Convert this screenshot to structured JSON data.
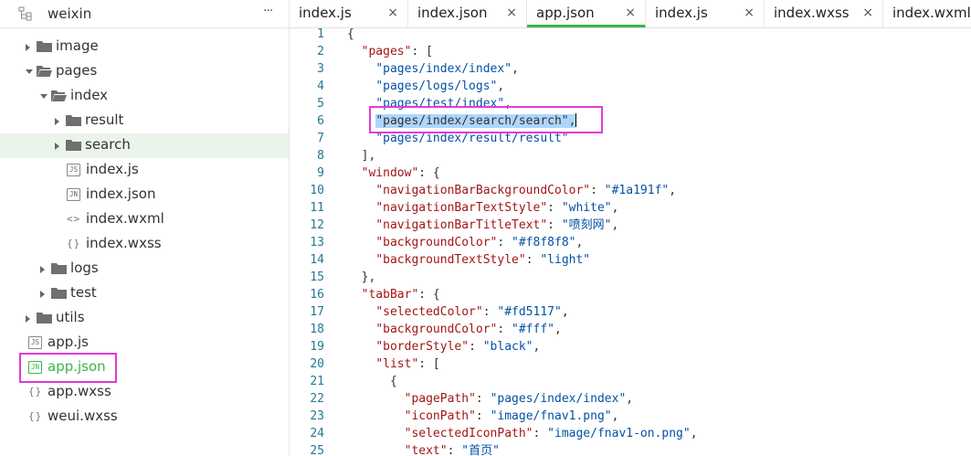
{
  "sidebar": {
    "project": "weixin",
    "more": "···",
    "tree": [
      {
        "label": "image",
        "type": "folder",
        "depth": 0,
        "state": "collapsed"
      },
      {
        "label": "pages",
        "type": "folder",
        "depth": 0,
        "state": "expanded"
      },
      {
        "label": "index",
        "type": "folder",
        "depth": 1,
        "state": "expanded"
      },
      {
        "label": "result",
        "type": "folder",
        "depth": 2,
        "state": "collapsed"
      },
      {
        "label": "search",
        "type": "folder",
        "depth": 2,
        "state": "collapsed",
        "selected": true
      },
      {
        "label": "index.js",
        "type": "file",
        "icon": "JS",
        "depth": 2
      },
      {
        "label": "index.json",
        "type": "file",
        "icon": "JN",
        "depth": 2
      },
      {
        "label": "index.wxml",
        "type": "file",
        "icon": "<>",
        "depth": 2
      },
      {
        "label": "index.wxss",
        "type": "file",
        "icon": "{}",
        "depth": 2
      },
      {
        "label": "logs",
        "type": "folder",
        "depth": 1,
        "state": "collapsed"
      },
      {
        "label": "test",
        "type": "folder",
        "depth": 1,
        "state": "collapsed"
      },
      {
        "label": "utils",
        "type": "folder",
        "depth": 0,
        "state": "collapsed"
      },
      {
        "label": "app.js",
        "type": "file",
        "icon": "JS",
        "depth": -1
      },
      {
        "label": "app.json",
        "type": "file",
        "icon": "JN",
        "depth": -1,
        "active": true
      },
      {
        "label": "app.wxss",
        "type": "file",
        "icon": "{}",
        "depth": -1
      },
      {
        "label": "weui.wxss",
        "type": "file",
        "icon": "{}",
        "depth": -1
      }
    ]
  },
  "tabs": [
    {
      "label": "index.js",
      "close": "×"
    },
    {
      "label": "index.json",
      "close": "×"
    },
    {
      "label": "app.json",
      "close": "×",
      "active": true
    },
    {
      "label": "index.js",
      "close": "×"
    },
    {
      "label": "index.wxss",
      "close": "×"
    },
    {
      "label": "index.wxml",
      "close": "×"
    }
  ],
  "editor": {
    "lines": [
      [
        [
          "p",
          "{"
        ]
      ],
      [
        [
          "p",
          "  "
        ],
        [
          "k",
          "\"pages\""
        ],
        [
          "p",
          ": ["
        ]
      ],
      [
        [
          "p",
          "    "
        ],
        [
          "s",
          "\"pages/index/index\""
        ],
        [
          "p",
          ","
        ]
      ],
      [
        [
          "p",
          "    "
        ],
        [
          "s",
          "\"pages/logs/logs\""
        ],
        [
          "p",
          ","
        ]
      ],
      [
        [
          "p",
          "    "
        ],
        [
          "s",
          "\"pages/test/index\""
        ],
        [
          "p",
          ","
        ]
      ],
      [
        [
          "p",
          "    "
        ],
        [
          "sel",
          "\"pages/index/search/search\","
        ],
        [
          "cursor",
          ""
        ]
      ],
      [
        [
          "p",
          "    "
        ],
        [
          "s",
          "\"pages/index/result/result\""
        ]
      ],
      [
        [
          "p",
          "  ],"
        ]
      ],
      [
        [
          "p",
          "  "
        ],
        [
          "k",
          "\"window\""
        ],
        [
          "p",
          ": {"
        ]
      ],
      [
        [
          "p",
          "    "
        ],
        [
          "k",
          "\"navigationBarBackgroundColor\""
        ],
        [
          "p",
          ": "
        ],
        [
          "s",
          "\"#1a191f\""
        ],
        [
          "p",
          ","
        ]
      ],
      [
        [
          "p",
          "    "
        ],
        [
          "k",
          "\"navigationBarTextStyle\""
        ],
        [
          "p",
          ": "
        ],
        [
          "s",
          "\"white\""
        ],
        [
          "p",
          ","
        ]
      ],
      [
        [
          "p",
          "    "
        ],
        [
          "k",
          "\"navigationBarTitleText\""
        ],
        [
          "p",
          ": "
        ],
        [
          "s",
          "\"喷刻网\""
        ],
        [
          "p",
          ","
        ]
      ],
      [
        [
          "p",
          "    "
        ],
        [
          "k",
          "\"backgroundColor\""
        ],
        [
          "p",
          ": "
        ],
        [
          "s",
          "\"#f8f8f8\""
        ],
        [
          "p",
          ","
        ]
      ],
      [
        [
          "p",
          "    "
        ],
        [
          "k",
          "\"backgroundTextStyle\""
        ],
        [
          "p",
          ": "
        ],
        [
          "s",
          "\"light\""
        ]
      ],
      [
        [
          "p",
          "  },"
        ]
      ],
      [
        [
          "p",
          "  "
        ],
        [
          "k",
          "\"tabBar\""
        ],
        [
          "p",
          ": {"
        ]
      ],
      [
        [
          "p",
          "    "
        ],
        [
          "k",
          "\"selectedColor\""
        ],
        [
          "p",
          ": "
        ],
        [
          "s",
          "\"#fd5117\""
        ],
        [
          "p",
          ","
        ]
      ],
      [
        [
          "p",
          "    "
        ],
        [
          "k",
          "\"backgroundColor\""
        ],
        [
          "p",
          ": "
        ],
        [
          "s",
          "\"#fff\""
        ],
        [
          "p",
          ","
        ]
      ],
      [
        [
          "p",
          "    "
        ],
        [
          "k",
          "\"borderStyle\""
        ],
        [
          "p",
          ": "
        ],
        [
          "s",
          "\"black\""
        ],
        [
          "p",
          ","
        ]
      ],
      [
        [
          "p",
          "    "
        ],
        [
          "k",
          "\"list\""
        ],
        [
          "p",
          ": ["
        ]
      ],
      [
        [
          "p",
          "      {"
        ]
      ],
      [
        [
          "p",
          "        "
        ],
        [
          "k",
          "\"pagePath\""
        ],
        [
          "p",
          ": "
        ],
        [
          "s",
          "\"pages/index/index\""
        ],
        [
          "p",
          ","
        ]
      ],
      [
        [
          "p",
          "        "
        ],
        [
          "k",
          "\"iconPath\""
        ],
        [
          "p",
          ": "
        ],
        [
          "s",
          "\"image/fnav1.png\""
        ],
        [
          "p",
          ","
        ]
      ],
      [
        [
          "p",
          "        "
        ],
        [
          "k",
          "\"selectedIconPath\""
        ],
        [
          "p",
          ": "
        ],
        [
          "s",
          "\"image/fnav1-on.png\""
        ],
        [
          "p",
          ","
        ]
      ],
      [
        [
          "p",
          "        "
        ],
        [
          "k",
          "\"text\""
        ],
        [
          "p",
          ": "
        ],
        [
          "s",
          "\"首页\""
        ]
      ]
    ]
  },
  "colors": {
    "accent": "#3bb54a",
    "highlight_box": "#e13bd8",
    "selection": "#add6ff",
    "line_number": "#237893"
  }
}
